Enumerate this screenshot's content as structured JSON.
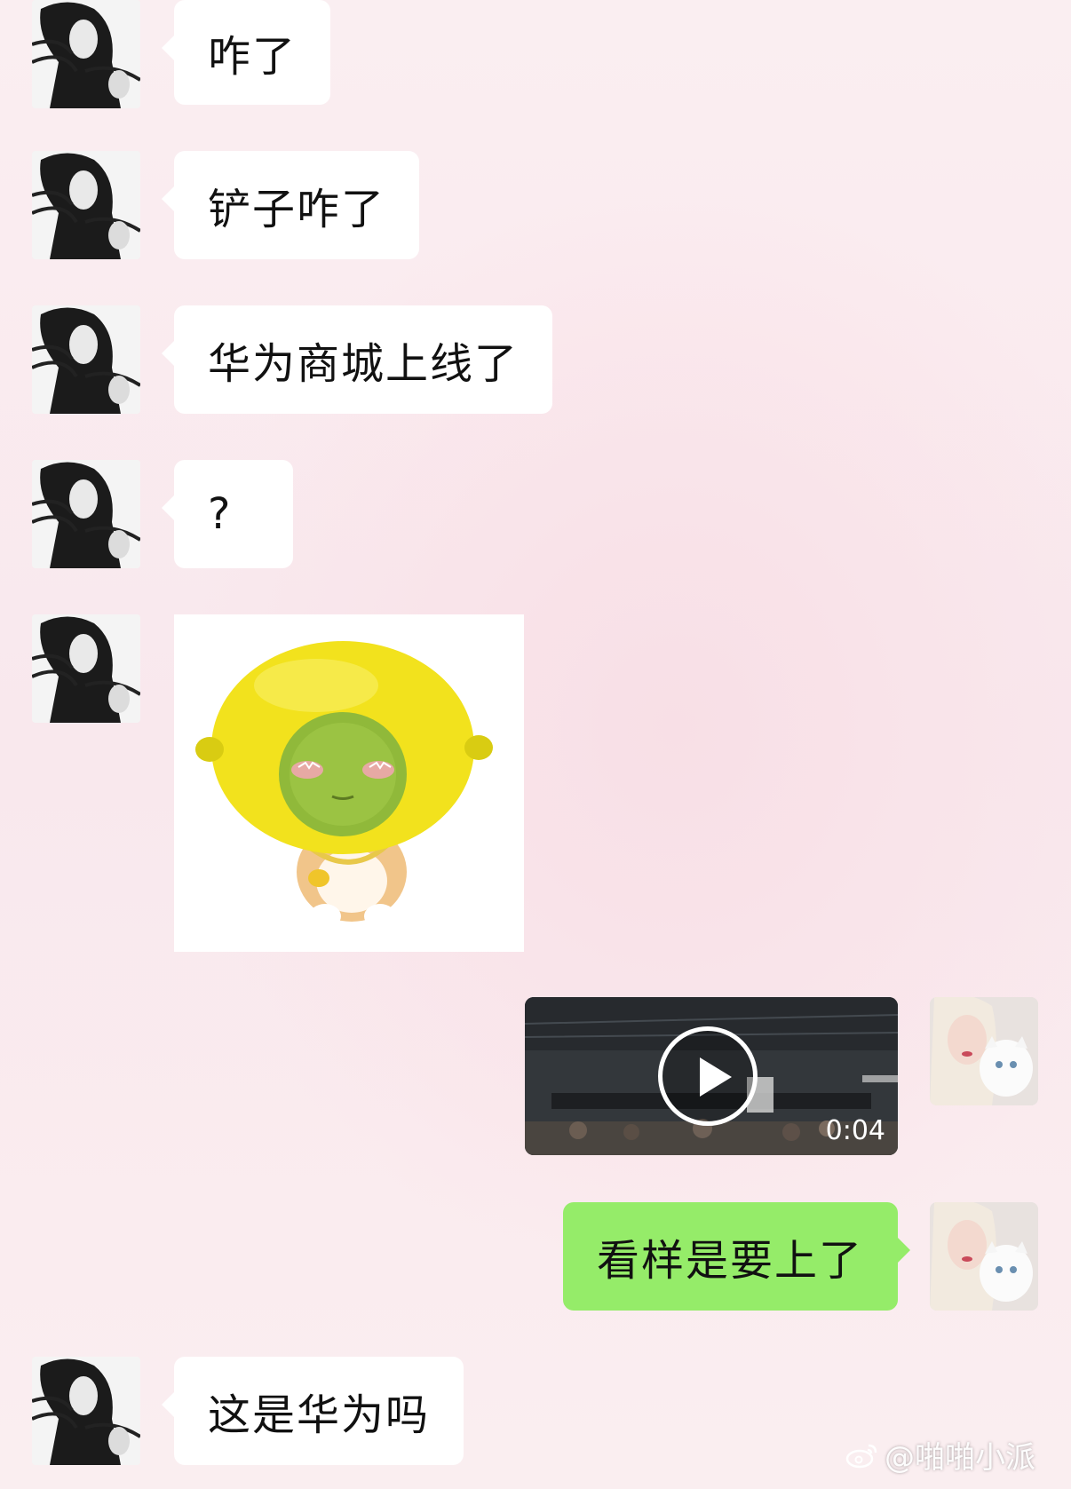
{
  "messages": [
    {
      "side": "left",
      "type": "text",
      "text": "咋了"
    },
    {
      "side": "left",
      "type": "text",
      "text": "铲子咋了"
    },
    {
      "side": "left",
      "type": "text",
      "text": "华为商城上线了"
    },
    {
      "side": "left",
      "type": "text",
      "text": "?"
    },
    {
      "side": "left",
      "type": "sticker",
      "icon": "lemon-cat-sticker"
    },
    {
      "side": "right",
      "type": "video",
      "duration": "0:04",
      "icon": "play-icon"
    },
    {
      "side": "right",
      "type": "text",
      "text": "看样是要上了"
    },
    {
      "side": "left",
      "type": "text",
      "text": "这是华为吗"
    }
  ],
  "colors": {
    "sent_bubble": "#95ec69",
    "received_bubble": "#ffffff"
  },
  "watermark": {
    "text": "@啪啪小派",
    "icon": "weibo-icon"
  }
}
